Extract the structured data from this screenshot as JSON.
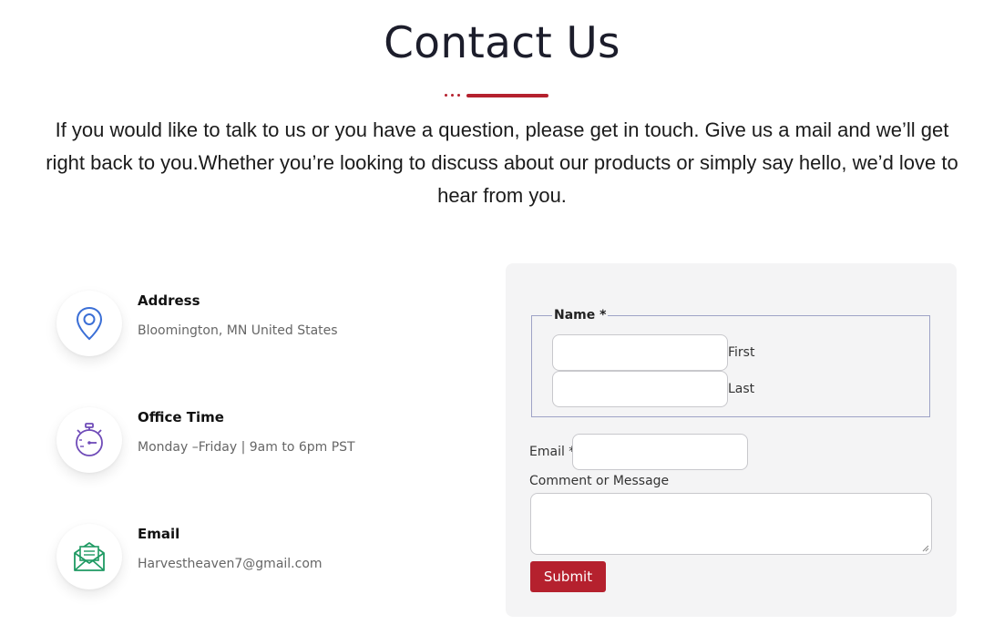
{
  "header": {
    "title": "Contact Us",
    "intro_line1": "If you would like to talk to us or you have a question, please get in touch. Give us a mail and we’ll get",
    "intro_line2": "right back to you.Whether you’re looking to discuss about our products or simply say hello, we’d love to",
    "intro_line3": "hear from you."
  },
  "info": [
    {
      "label": "Address",
      "value": "Bloomington, MN United States",
      "icon": "map-pin-icon",
      "icon_color": "#3b6fd6"
    },
    {
      "label": "Office Time",
      "value": "Monday –Friday | 9am to 6pm PST",
      "icon": "stopwatch-icon",
      "icon_color": "#6f4bb8"
    },
    {
      "label": "Email",
      "value": "Harvestheaven7@gmail.com",
      "icon": "envelope-icon",
      "icon_color": "#1f9a63"
    }
  ],
  "form": {
    "name_legend": "Name *",
    "first_label": "First",
    "first_value": "",
    "last_label": "Last",
    "last_value": "",
    "email_label": "Email *",
    "email_value": "",
    "message_label": "Comment or Message",
    "message_value": "",
    "submit_label": "Submit"
  },
  "colors": {
    "accent": "#b5212e",
    "title": "#1c1d2b",
    "form_bg": "#f4f4f5"
  }
}
